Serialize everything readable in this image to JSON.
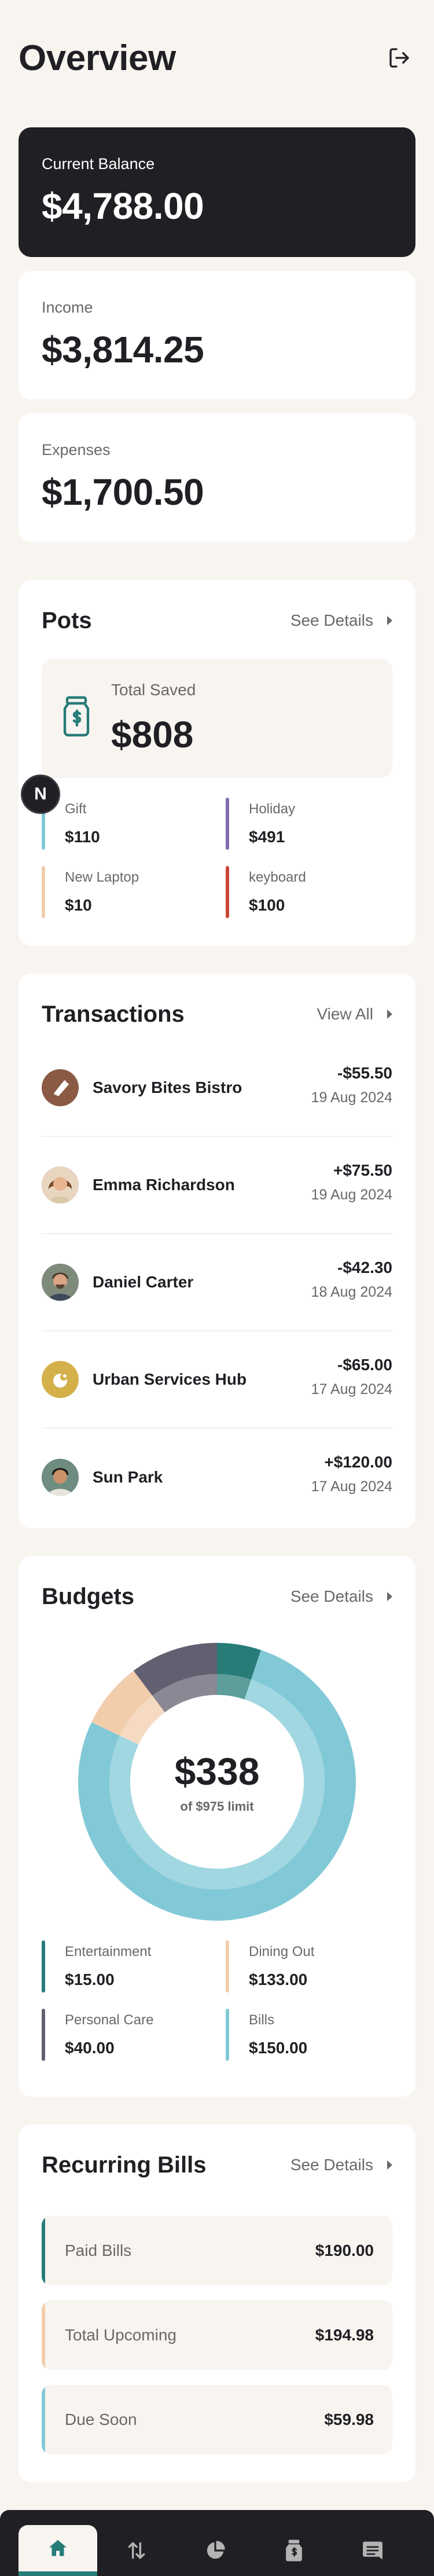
{
  "header": {
    "title": "Overview",
    "logout_icon": "logout-icon"
  },
  "summary": {
    "current_balance": {
      "label": "Current Balance",
      "value": "$4,788.00"
    },
    "income": {
      "label": "Income",
      "value": "$3,814.25"
    },
    "expenses": {
      "label": "Expenses",
      "value": "$1,700.50"
    }
  },
  "pots": {
    "title": "Pots",
    "link": "See Details",
    "total_saved_label": "Total Saved",
    "total_saved_value": "$808",
    "items": [
      {
        "label": "Gift",
        "value": "$110",
        "color": "#82C9D7"
      },
      {
        "label": "Holiday",
        "value": "$491",
        "color": "#826CB0"
      },
      {
        "label": "New Laptop",
        "value": "$10",
        "color": "#F2CDAC"
      },
      {
        "label": "keyboard",
        "value": "$100",
        "color": "#C94736"
      }
    ]
  },
  "badge": {
    "letter": "N"
  },
  "transactions": {
    "title": "Transactions",
    "link": "View All",
    "items": [
      {
        "name": "Savory Bites Bistro",
        "amount": "-$55.50",
        "date": "19 Aug 2024",
        "avatar": "food-logo-icon"
      },
      {
        "name": "Emma Richardson",
        "amount": "+$75.50",
        "date": "19 Aug 2024",
        "avatar": "person-avatar"
      },
      {
        "name": "Daniel Carter",
        "amount": "-$42.30",
        "date": "18 Aug 2024",
        "avatar": "person-avatar"
      },
      {
        "name": "Urban Services Hub",
        "amount": "-$65.00",
        "date": "17 Aug 2024",
        "avatar": "services-logo-icon"
      },
      {
        "name": "Sun Park",
        "amount": "+$120.00",
        "date": "17 Aug 2024",
        "avatar": "person-avatar"
      }
    ]
  },
  "budgets": {
    "title": "Budgets",
    "link": "See Details",
    "center_value": "$338",
    "center_sub": "of $975 limit",
    "items": [
      {
        "label": "Entertainment",
        "value": "$15.00",
        "color": "#277C78"
      },
      {
        "label": "Dining Out",
        "value": "$133.00",
        "color": "#F2CDAC"
      },
      {
        "label": "Personal Care",
        "value": "$40.00",
        "color": "#626070"
      },
      {
        "label": "Bills",
        "value": "$150.00",
        "color": "#82C9D7"
      }
    ]
  },
  "chart_data": {
    "type": "pie",
    "categories": [
      "Entertainment",
      "Bills",
      "Dining Out",
      "Personal Care"
    ],
    "values": [
      50,
      750,
      75,
      100
    ],
    "colors": [
      "#277C78",
      "#82C9D7",
      "#F2CDAC",
      "#626070"
    ],
    "title": "",
    "center_label": "$338",
    "center_sublabel": "of $975 limit"
  },
  "recurring": {
    "title": "Recurring Bills",
    "link": "See Details",
    "items": [
      {
        "label": "Paid Bills",
        "value": "$190.00",
        "color": "#277C78"
      },
      {
        "label": "Total Upcoming",
        "value": "$194.98",
        "color": "#F2CDAC"
      },
      {
        "label": "Due Soon",
        "value": "$59.98",
        "color": "#82C9D7"
      }
    ]
  },
  "nav": {
    "items": [
      {
        "icon": "home-icon",
        "active": true
      },
      {
        "icon": "transactions-icon",
        "active": false
      },
      {
        "icon": "budgets-icon",
        "active": false
      },
      {
        "icon": "pots-icon",
        "active": false
      },
      {
        "icon": "recurring-bills-icon",
        "active": false
      }
    ]
  }
}
